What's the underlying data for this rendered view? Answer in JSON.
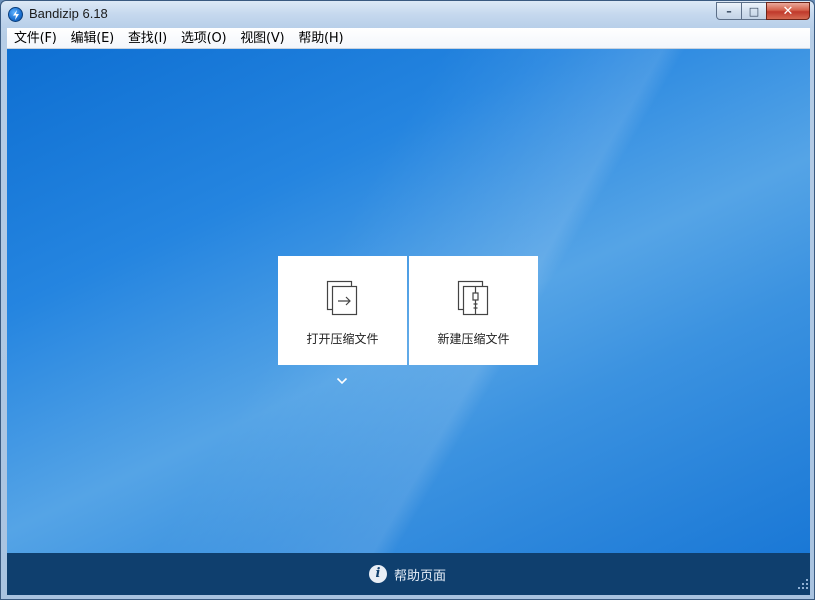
{
  "window": {
    "title": "Bandizip 6.18"
  },
  "caption": {
    "minimize": "–",
    "maximize": "□",
    "close": "✕"
  },
  "menubar": {
    "items": [
      "文件(F)",
      "编辑(E)",
      "查找(I)",
      "选项(O)",
      "视图(V)",
      "帮助(H)"
    ]
  },
  "tiles": {
    "open": {
      "label": "打开压缩文件",
      "icon": "open-archive-icon"
    },
    "new": {
      "label": "新建压缩文件",
      "icon": "new-archive-icon"
    }
  },
  "footer": {
    "help_label": "帮助页面",
    "info_glyph": "i"
  },
  "colors": {
    "accent": "#1a78d6",
    "footer": "#0f3f6e"
  }
}
